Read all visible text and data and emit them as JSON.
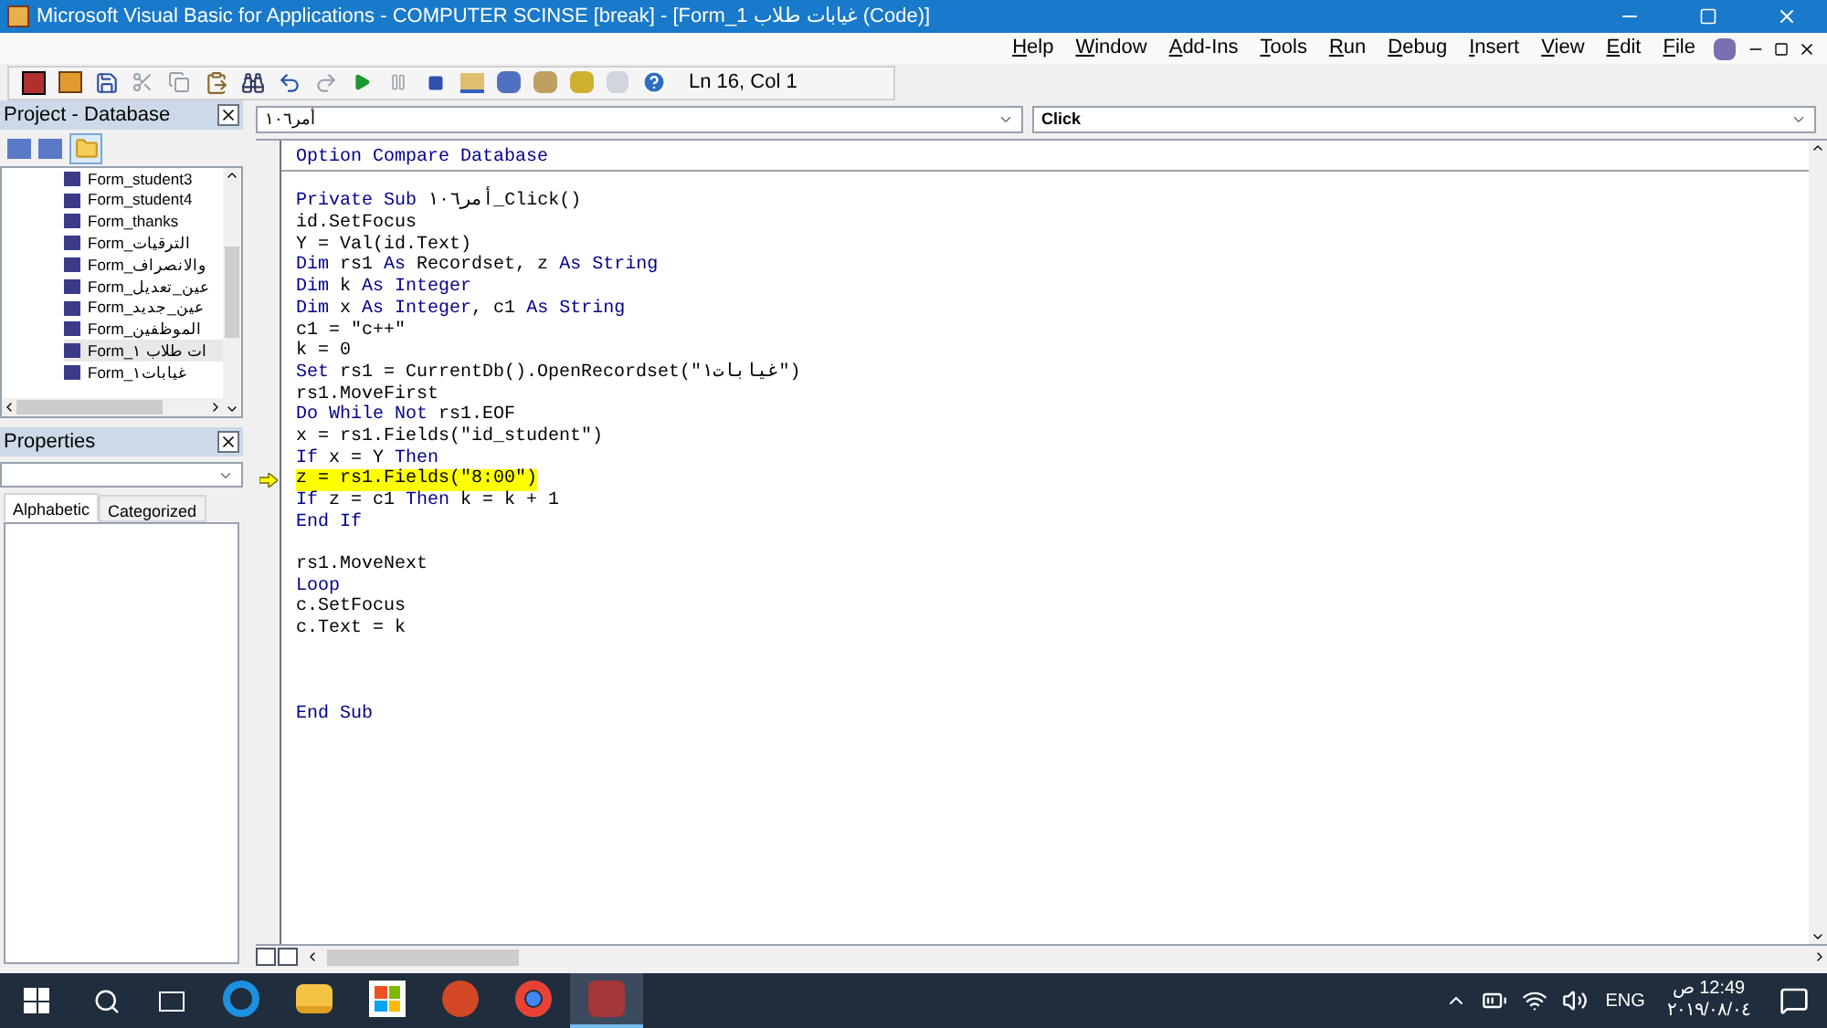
{
  "window": {
    "title": "Microsoft Visual Basic for Applications - COMPUTER SCINSE [break] - [Form_1 غيابات طلاب (Code)]"
  },
  "menu": [
    "Help",
    "Window",
    "Add-Ins",
    "Tools",
    "Run",
    "Debug",
    "Insert",
    "View",
    "Edit",
    "File"
  ],
  "toolbar": {
    "position": "Ln 16, Col 1"
  },
  "project": {
    "title": "Project - Database",
    "items": [
      {
        "label": "Form_student3",
        "selected": false
      },
      {
        "label": "Form_student4",
        "selected": false
      },
      {
        "label": "Form_thanks",
        "selected": false
      },
      {
        "label": "Form_الترقيات",
        "selected": false
      },
      {
        "label": "Form_والانصراف",
        "selected": false
      },
      {
        "label": "Form_عين_تعديل",
        "selected": false
      },
      {
        "label": "Form_عين_جديد",
        "selected": false
      },
      {
        "label": "Form_الموظفين",
        "selected": false
      },
      {
        "label": "Form_ات طلاب ١",
        "selected": true
      },
      {
        "label": "Form_غيابات١",
        "selected": false
      }
    ]
  },
  "properties": {
    "title": "Properties",
    "tabs": [
      {
        "label": "Alphabetic",
        "selected": true
      },
      {
        "label": "Categorized",
        "selected": false
      }
    ]
  },
  "code": {
    "object": "أمر١٠٦",
    "procedure": "Click",
    "lines": [
      {
        "kind": "code",
        "current": false,
        "segments": [
          {
            "text": "Option Compare Database",
            "kind": "keyword"
          }
        ]
      },
      {
        "kind": "separator"
      },
      {
        "kind": "blank"
      },
      {
        "kind": "code",
        "current": false,
        "segments": [
          {
            "text": "Private Sub",
            "kind": "keyword"
          },
          {
            "text": " أمر١٠٦_Click()",
            "kind": "plain"
          }
        ]
      },
      {
        "kind": "code",
        "current": false,
        "segments": [
          {
            "text": "id.SetFocus",
            "kind": "plain"
          }
        ]
      },
      {
        "kind": "code",
        "current": false,
        "segments": [
          {
            "text": "Y = Val(id.Text)",
            "kind": "plain"
          }
        ]
      },
      {
        "kind": "code",
        "current": false,
        "segments": [
          {
            "text": "Dim",
            "kind": "keyword"
          },
          {
            "text": " rs1 ",
            "kind": "plain"
          },
          {
            "text": "As",
            "kind": "keyword"
          },
          {
            "text": " Recordset, z ",
            "kind": "plain"
          },
          {
            "text": "As String",
            "kind": "keyword"
          }
        ]
      },
      {
        "kind": "code",
        "current": false,
        "segments": [
          {
            "text": "Dim",
            "kind": "keyword"
          },
          {
            "text": " k ",
            "kind": "plain"
          },
          {
            "text": "As Integer",
            "kind": "keyword"
          }
        ]
      },
      {
        "kind": "code",
        "current": false,
        "segments": [
          {
            "text": "Dim",
            "kind": "keyword"
          },
          {
            "text": " x ",
            "kind": "plain"
          },
          {
            "text": "As Integer",
            "kind": "keyword"
          },
          {
            "text": ", c1 ",
            "kind": "plain"
          },
          {
            "text": "As String",
            "kind": "keyword"
          }
        ]
      },
      {
        "kind": "code",
        "current": false,
        "segments": [
          {
            "text": "c1 = \"c++\"",
            "kind": "plain"
          }
        ]
      },
      {
        "kind": "code",
        "current": false,
        "segments": [
          {
            "text": "k = 0",
            "kind": "plain"
          }
        ]
      },
      {
        "kind": "code",
        "current": false,
        "segments": [
          {
            "text": "Set",
            "kind": "keyword"
          },
          {
            "text": " rs1 = CurrentDb().OpenRecordset(\"غيابات١\")",
            "kind": "plain"
          }
        ]
      },
      {
        "kind": "code",
        "current": false,
        "segments": [
          {
            "text": "rs1.MoveFirst",
            "kind": "plain"
          }
        ]
      },
      {
        "kind": "code",
        "current": false,
        "segments": [
          {
            "text": "Do While Not",
            "kind": "keyword"
          },
          {
            "text": " rs1.EOF",
            "kind": "plain"
          }
        ]
      },
      {
        "kind": "code",
        "current": false,
        "segments": [
          {
            "text": "x = rs1.Fields(\"id_student\")",
            "kind": "plain"
          }
        ]
      },
      {
        "kind": "code",
        "current": false,
        "segments": [
          {
            "text": "If",
            "kind": "keyword"
          },
          {
            "text": " x = Y ",
            "kind": "plain"
          },
          {
            "text": "Then",
            "kind": "keyword"
          }
        ]
      },
      {
        "kind": "code",
        "current": true,
        "segments": [
          {
            "text": "z = rs1.Fields(\"8:00\")",
            "kind": "plain"
          }
        ]
      },
      {
        "kind": "code",
        "current": false,
        "segments": [
          {
            "text": "If",
            "kind": "keyword"
          },
          {
            "text": " z = c1 ",
            "kind": "plain"
          },
          {
            "text": "Then",
            "kind": "keyword"
          },
          {
            "text": " k = k + 1",
            "kind": "plain"
          }
        ]
      },
      {
        "kind": "code",
        "current": false,
        "segments": [
          {
            "text": "End If",
            "kind": "keyword"
          }
        ]
      },
      {
        "kind": "blank"
      },
      {
        "kind": "code",
        "current": false,
        "segments": [
          {
            "text": "rs1.MoveNext",
            "kind": "plain"
          }
        ]
      },
      {
        "kind": "code",
        "current": false,
        "segments": [
          {
            "text": "Loop",
            "kind": "keyword"
          }
        ]
      },
      {
        "kind": "code",
        "current": false,
        "segments": [
          {
            "text": "c.SetFocus",
            "kind": "plain"
          }
        ]
      },
      {
        "kind": "code",
        "current": false,
        "segments": [
          {
            "text": "c.Text = k",
            "kind": "plain"
          }
        ]
      },
      {
        "kind": "blank"
      },
      {
        "kind": "blank"
      },
      {
        "kind": "blank"
      },
      {
        "kind": "code",
        "current": false,
        "segments": [
          {
            "text": "End Sub",
            "kind": "keyword"
          }
        ]
      }
    ]
  },
  "taskbar": {
    "apps": [
      {
        "kind": "edge",
        "selected": false
      },
      {
        "kind": "explorer",
        "selected": false
      },
      {
        "kind": "store",
        "selected": false
      },
      {
        "kind": "powerpoint",
        "selected": false
      },
      {
        "kind": "chrome",
        "selected": false
      },
      {
        "kind": "access",
        "selected": true
      }
    ],
    "language": "ENG",
    "time": "12:49 ص",
    "date": "٢٠١٩/٠٨/٠٤"
  }
}
